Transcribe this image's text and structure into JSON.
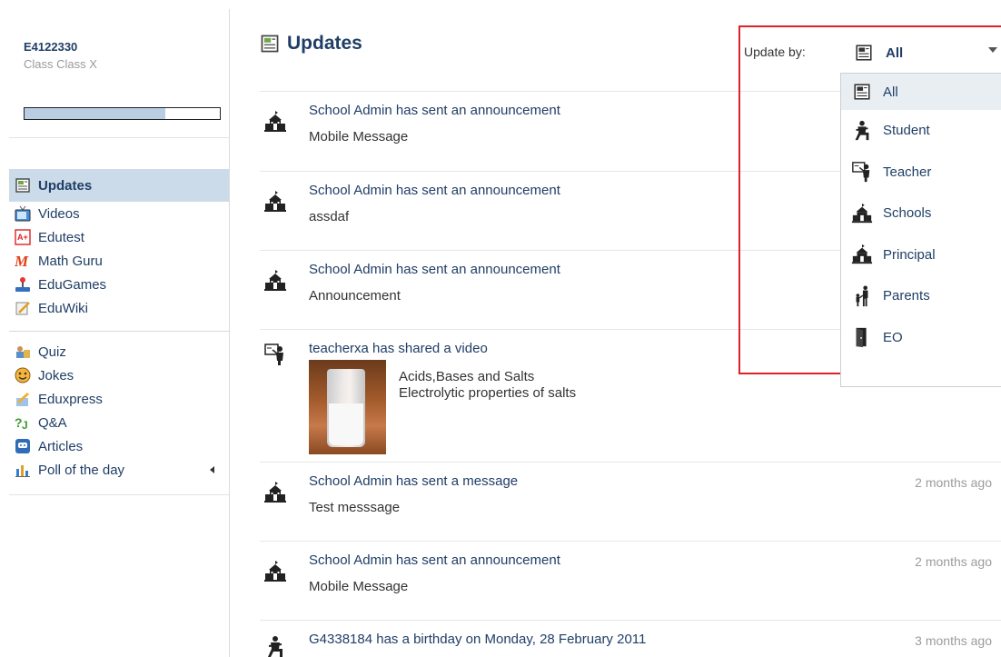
{
  "profile": {
    "user_id": "E4122330",
    "class_label": "Class Class X",
    "progress_fraction": 0.72
  },
  "nav": {
    "group1": [
      {
        "label": "Updates",
        "icon": "updates-icon",
        "active": true
      },
      {
        "label": "Videos",
        "icon": "tv-icon"
      },
      {
        "label": "Edutest",
        "icon": "edutest-icon"
      },
      {
        "label": "Math Guru",
        "icon": "math-guru-icon"
      },
      {
        "label": "EduGames",
        "icon": "joystick-icon"
      },
      {
        "label": "EduWiki",
        "icon": "pencil-note-icon"
      }
    ],
    "group2": [
      {
        "label": "Quiz",
        "icon": "quiz-icon"
      },
      {
        "label": "Jokes",
        "icon": "smiley-icon"
      },
      {
        "label": "Eduxpress",
        "icon": "eduxpress-icon"
      },
      {
        "label": "Q&A",
        "icon": "qa-icon"
      },
      {
        "label": "Articles",
        "icon": "articles-icon"
      },
      {
        "label": "Poll of the day",
        "icon": "bar-chart-icon"
      }
    ]
  },
  "main": {
    "title": "Updates"
  },
  "update_by": {
    "label": "Update by:",
    "selected": "All",
    "options": [
      "All",
      "Student",
      "Teacher",
      "Schools",
      "Principal",
      "Parents",
      "EO"
    ]
  },
  "feed": [
    {
      "head": "School Admin has sent an announcement",
      "body": "Mobile Message",
      "time": "",
      "icon": "school-icon"
    },
    {
      "head": "School Admin has sent an announcement",
      "body": "assdaf",
      "time": "",
      "icon": "school-icon"
    },
    {
      "head": "School Admin has sent an announcement",
      "body": "Announcement",
      "time": "",
      "icon": "school-icon"
    },
    {
      "head": "teacherxa has shared a video",
      "video_title": "Acids,Bases and Salts",
      "video_sub": "Electrolytic properties of salts",
      "time": "",
      "icon": "teacher-icon"
    },
    {
      "head": "School Admin has sent a message",
      "body": "Test messsage",
      "time": "2 months ago",
      "icon": "school-icon"
    },
    {
      "head": "School Admin has sent an announcement",
      "body": "Mobile Message",
      "time": "2 months ago",
      "icon": "school-icon"
    },
    {
      "head": "G4338184 has a birthday on Monday, 28 February 2011",
      "body": "",
      "time": "3 months ago",
      "icon": "student-icon"
    }
  ],
  "colors": {
    "accent": "#1f3e66",
    "active_bg": "#ccdbe9",
    "highlight_border": "#e0202a"
  }
}
